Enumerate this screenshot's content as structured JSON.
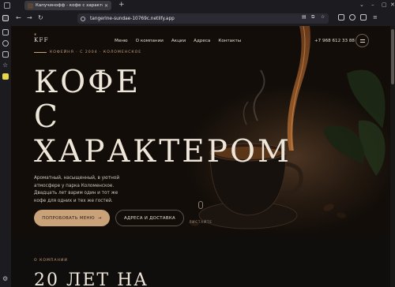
{
  "browser": {
    "tab_title": "Капучинофф - кофе с характером",
    "url": "tangerine-sundae-10769c.netlify.app"
  },
  "site": {
    "logo": "KFF",
    "nav": [
      "Меню",
      "О компании",
      "Акции",
      "Адреса",
      "Контакты"
    ],
    "phone": "+7 968 612 33 88",
    "eyebrow": "КОФЕЙНЯ · С 2004 · КОЛОМЕНСКОЕ",
    "headline": [
      "КОФЕ",
      "С",
      "ХАРАКТЕРОМ"
    ],
    "lede": "Ароматный, насыщенный, в уютной атмосфере у парка Коломенское. Двадцать лет варим один и тот же кофе для одних и тех же гостей.",
    "cta_primary": "ПОПРОБОВАТЬ МЕНЮ",
    "cta_primary_arrow": "→",
    "cta_secondary": "АДРЕСА И ДОСТАВКА",
    "scroll_hint": "ЛИСТАЙТЕ",
    "about_eyebrow": "О КОМПАНИИ",
    "about_title": "20 ЛЕТ НА"
  },
  "colors": {
    "accent": "#c9a27a",
    "text": "#efe6da",
    "background": "#0e0c0a"
  }
}
